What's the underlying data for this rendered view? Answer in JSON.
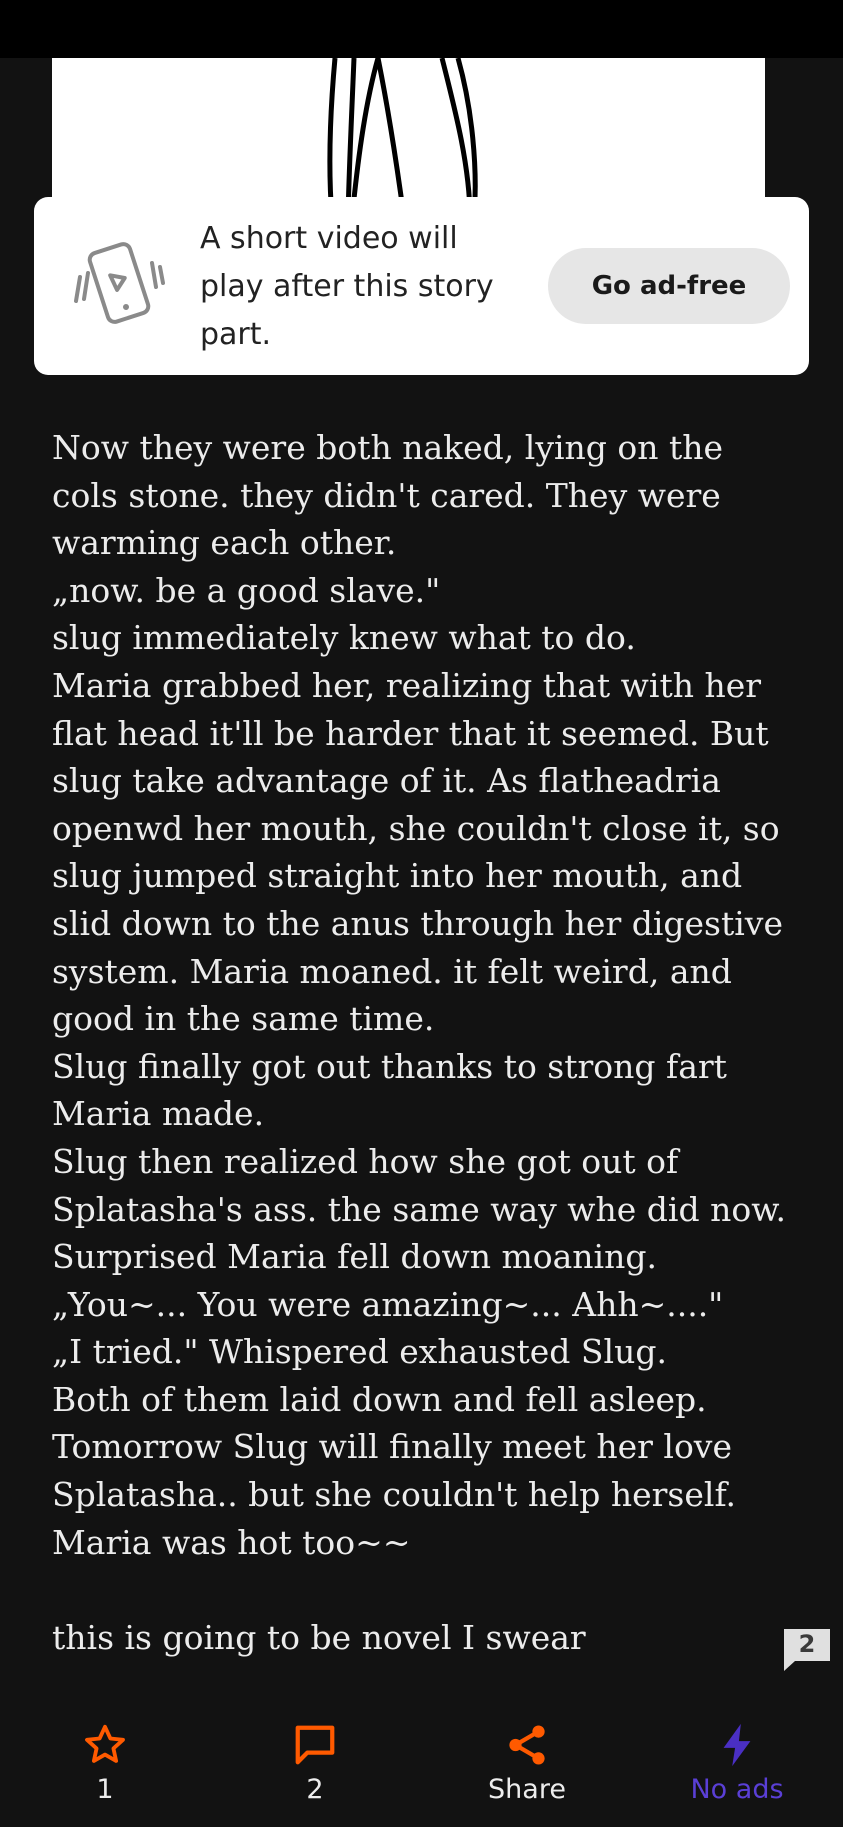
{
  "ad": {
    "text_lines": [
      "A short video will",
      "play after this story",
      "part."
    ],
    "button_label": "Go ad-free"
  },
  "story": {
    "lines": [
      "Now they were both naked, lying on the",
      "cols stone. they didn't cared. They were",
      "warming each other.",
      "„now. be a good slave.\"",
      "slug immediately knew what to do.",
      "Maria grabbed her, realizing that with her",
      "flat head it'll be harder that it seemed. But",
      "slug take advantage of it. As flatheadria",
      "openwd her mouth, she couldn't close it, so",
      "slug jumped straight into her mouth, and",
      "slid down to the anus through her digestive",
      "system. Maria moaned. it felt weird, and",
      "good in the same time.",
      "Slug finally got out thanks to strong fart",
      "Maria made.",
      "Slug then realized how she got out of",
      "Splatasha's ass. the same way whe did now.",
      "Surprised Maria fell down moaning.",
      "„You~... You were amazing~... Ahh~....\"",
      "„I tried.\" Whispered exhausted Slug.",
      "Both of them laid down and fell asleep.",
      "Tomorrow Slug will finally meet her love",
      "Splatasha.. but she couldn't help herself.",
      "Maria was hot too~~"
    ],
    "closing_line": "this is going to be novel I swear"
  },
  "paragraph_comment_count": "2",
  "bottom_bar": {
    "vote": {
      "icon": "star-icon",
      "label": "1"
    },
    "comments": {
      "icon": "comment-icon",
      "label": "2"
    },
    "share": {
      "icon": "share-icon",
      "label": "Share"
    },
    "no_ads": {
      "icon": "lightning-icon",
      "label": "No ads"
    }
  },
  "colors": {
    "background": "#121212",
    "accent_orange": "#ff5a00",
    "accent_purple": "#5a3fd6",
    "text": "#ececec"
  }
}
